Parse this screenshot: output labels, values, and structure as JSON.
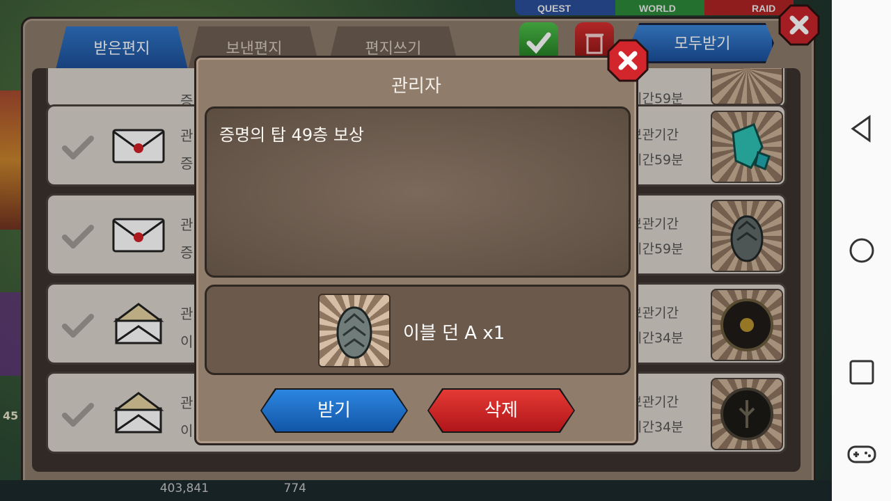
{
  "background_tabs": [
    "QUEST",
    "WORLD",
    "RAID"
  ],
  "mailbox": {
    "tabs": [
      {
        "label": "받은편지",
        "active": true
      },
      {
        "label": "보낸편지",
        "active": false
      },
      {
        "label": "편지쓰기",
        "active": false
      }
    ],
    "receive_all_label": "모두받기",
    "rows": [
      {
        "title": "관",
        "subtitle": "증",
        "expire_label": "보관기간",
        "expire_time": "시간59분",
        "envelope": "sealed",
        "reward": "crystal-icon"
      },
      {
        "title": "관",
        "subtitle": "증",
        "expire_label": "보관기간",
        "expire_time": "시간59분",
        "envelope": "sealed",
        "reward": "egg-icon"
      },
      {
        "title": "관",
        "subtitle": "이",
        "expire_label": "보관기간",
        "expire_time": "시간34분",
        "envelope": "opened",
        "reward": "dark-emblem-icon"
      },
      {
        "title": "관",
        "subtitle": "이",
        "expire_label": "보관기간",
        "expire_time": "시간34분",
        "envelope": "opened",
        "reward": "tree-emblem-icon"
      }
    ],
    "partial_top_row_expire": "시간59분",
    "partial_top_row_subtitle": "증"
  },
  "currency": {
    "gold": "403,841",
    "gems": "774"
  },
  "level_badge": "45",
  "modal": {
    "title": "관리자",
    "message": "증명의 탑 49층 보상",
    "item_label": "이블 던 A x1",
    "item_icon": "egg-icon",
    "receive_label": "받기",
    "delete_label": "삭제"
  },
  "colors": {
    "accent_blue": "#1d5fb0",
    "accent_red": "#c41c1e",
    "panel_brown": "#8f7c6a"
  }
}
